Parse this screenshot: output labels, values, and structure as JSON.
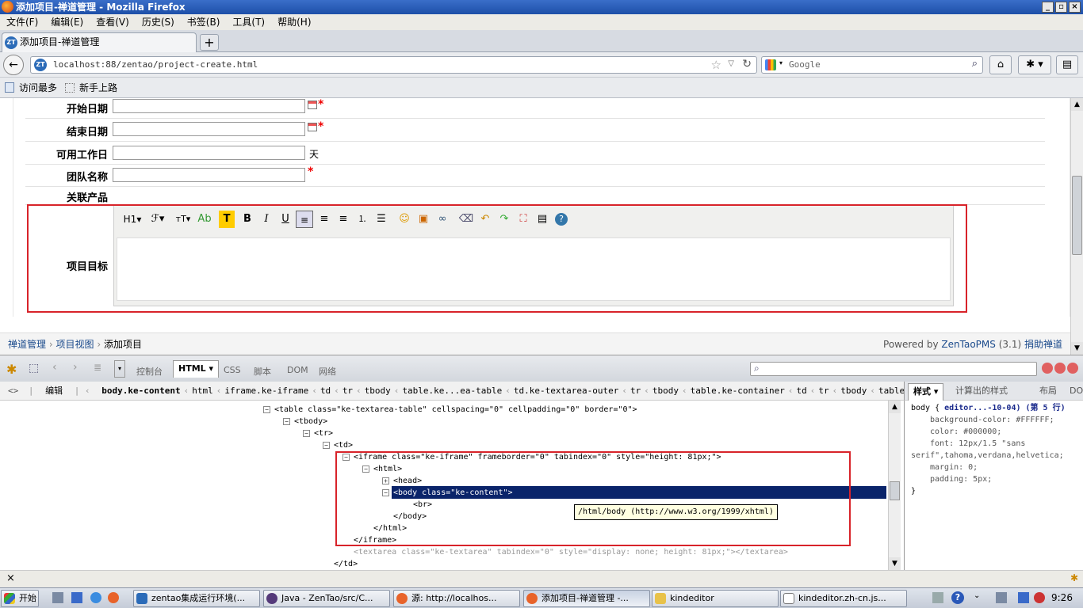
{
  "window": {
    "title": "添加项目-禅道管理 - Mozilla Firefox"
  },
  "menu": [
    "文件(F)",
    "编辑(E)",
    "查看(V)",
    "历史(S)",
    "书签(B)",
    "工具(T)",
    "帮助(H)"
  ],
  "tab": {
    "label": "添加项目-禅道管理",
    "icon_text": "ZT"
  },
  "nav": {
    "url": "localhost:88/zentao/project-create.html",
    "search_placeholder": "Google"
  },
  "bookmarks": [
    "访问最多",
    "新手上路"
  ],
  "form": {
    "begin_label": "开始日期",
    "end_label": "结束日期",
    "days_label": "可用工作日",
    "days_unit": "天",
    "team_label": "团队名称",
    "products_label": "关联产品",
    "goal_label": "项目目标",
    "required_mark": "*"
  },
  "editor_toolbar": [
    "H1",
    "ℱ",
    "тT",
    "Ab",
    "T",
    "B",
    "I",
    "U"
  ],
  "footer": {
    "crumbs": [
      "禅道管理",
      "项目视图",
      "添加项目"
    ],
    "powered_prefix": "Powered by",
    "powered_link": "ZenTaoPMS",
    "version": "(3.1)",
    "donate": "捐助禅道"
  },
  "firebug": {
    "tabs": [
      "控制台",
      "HTML",
      "CSS",
      "脚本",
      "DOM",
      "网络"
    ],
    "edit_label": "编辑",
    "crumbs": [
      "body.ke-content",
      "html",
      "iframe.ke-iframe",
      "td",
      "tr",
      "tbody",
      "table.ke...ea-table",
      "td.ke-textarea-outer",
      "tr",
      "tbody",
      "table.ke-container",
      "td",
      "tr",
      "tbody",
      "table.table-1"
    ],
    "side_tabs": [
      "样式",
      "计算出的样式",
      "布局",
      "DOM"
    ],
    "tooltip": "/html/body (http://www.w3.org/1999/xhtml)",
    "style_selector": "body {",
    "style_source": "editor...-10-04) (第 5 行)",
    "style_rules": [
      "background-color: #FFFFFF;",
      "color: #000000;",
      "font: 12px/1.5 \"sans",
      "serif\",tahoma,verdana,helvetica;",
      "margin: 0;",
      "padding: 5px;"
    ],
    "style_close": "}",
    "tree": [
      "<table class=\"ke-textarea-table\" cellspacing=\"0\" cellpadding=\"0\" border=\"0\">",
      "<tbody>",
      "<tr>",
      "<td>",
      "<iframe class=\"ke-iframe\" frameborder=\"0\" tabindex=\"0\" style=\"height: 81px;\">",
      "<html>",
      "<head>",
      "<body class=\"ke-content\">",
      "<br>",
      "</body>",
      "</html>",
      "</iframe>",
      "<textarea class=\"ke-textarea\" tabindex=\"0\" style=\"display: none; height: 81px;\"></textarea>",
      "</td>"
    ]
  },
  "taskbar": {
    "start": "开始",
    "tasks": [
      "zentao集成运行环境(...",
      "Java - ZenTao/src/C...",
      "源: http://localhos...",
      "添加项目-禅道管理 -...",
      "kindeditor",
      "kindeditor.zh-cn.js..."
    ],
    "clock": "9:26"
  }
}
